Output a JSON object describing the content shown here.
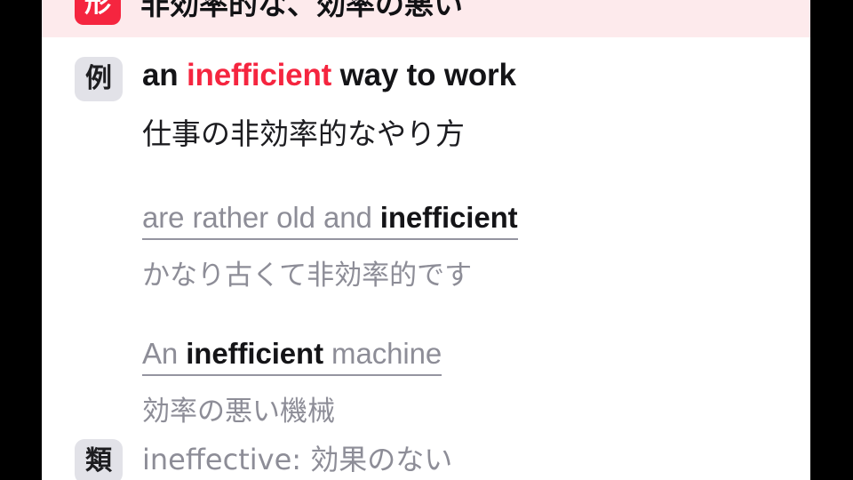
{
  "window": {
    "background_color": "#000000",
    "content_background": "#ffffff"
  },
  "colors": {
    "keyword_red": "#f5253f",
    "pos_row_background": "#fdeaec",
    "badge_gray_background": "#e2e2e8",
    "muted_text": "#8d8d97",
    "primary_text": "#141417",
    "underline": "#9595a0"
  },
  "entry": {
    "part_of_speech_row": {
      "badge_label": "形",
      "definition": "非効率的な、効率の悪い"
    },
    "example_section": {
      "badge_label": "例",
      "items": [
        {
          "english_prefix": "an ",
          "english_keyword": "inefficient",
          "english_suffix": " way to work",
          "japanese": "仕事の非効率的なやり方",
          "style": "primary"
        },
        {
          "english_prefix": "are rather old and ",
          "english_keyword": "inefficient",
          "english_suffix": "",
          "japanese": "かなり古くて非効率的です",
          "style": "muted-underlined"
        },
        {
          "english_prefix": "An ",
          "english_keyword": "inefficient",
          "english_suffix": " machine",
          "japanese": "効率の悪い機械",
          "style": "muted-underlined"
        }
      ]
    },
    "synonym_row": {
      "badge_label": "類",
      "text": "ineffective: 効果のない"
    }
  }
}
